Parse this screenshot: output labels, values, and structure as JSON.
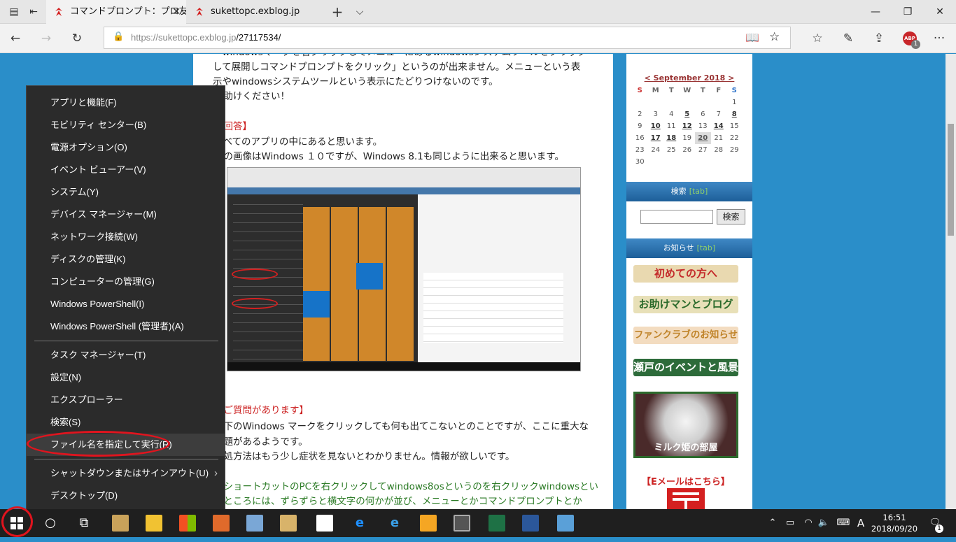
{
  "browser": {
    "tabs": [
      {
        "title": "コマンドプロンプト：プロ友パ"
      },
      {
        "title": "sukettopc.exblog.jp"
      }
    ],
    "url_host": "https://sukettopc.exblog.jp",
    "url_path": "/27117534/",
    "abp_badge": "ABP",
    "abp_count": "1"
  },
  "article": {
    "lines": [
      "「windowsマークを右クリックしてメニューにあるwindowsシステムツールをクリック",
      "して展開しコマンドプロンプトをクリック」というのが出来ません。メニューという表",
      "示やwindowsシステムツールという表示にたどりつけないのです。",
      "お助けください！",
      "【回答】",
      "すべてのアプリの中にあると思います。",
      "この画像はWindows １０ですが、Windows 8.1も同じように出来ると思います。",
      "【ご質問があります】",
      "左下のWindows マークをクリックしても何も出てこないとのことですが、ここに重大な",
      "問題があるようです。",
      "対処方法はもう少し症状を見ないとわかりません。情報が欲しいです。",
      "・ショートカットのPCを右クリックしてwindows8osというのを右クリックwindowsとい",
      "うところには、ずらずらと横文字の何かが並び、メニューとかコマンドプロンプトとか"
    ]
  },
  "sidebar": {
    "calendar_month": "< September 2018 >",
    "weekdays": [
      "S",
      "M",
      "T",
      "W",
      "T",
      "F",
      "S"
    ],
    "weeks": [
      [
        "",
        "",
        "",
        "",
        "",
        "",
        "1"
      ],
      [
        "2",
        "3",
        "4",
        "5",
        "6",
        "7",
        "8"
      ],
      [
        "9",
        "10",
        "11",
        "12",
        "13",
        "14",
        "15"
      ],
      [
        "16",
        "17",
        "18",
        "19",
        "20",
        "21",
        "22"
      ],
      [
        "23",
        "24",
        "25",
        "26",
        "27",
        "28",
        "29"
      ],
      [
        "30",
        "",
        "",
        "",
        "",
        "",
        ""
      ]
    ],
    "search_title": "検索",
    "search_tag": "[tab]",
    "search_button": "検索",
    "news_title": "お知らせ",
    "news_tag": "[tab]",
    "banners": [
      "初めての方へ",
      "お助けマンとブログ",
      "ファンクラブのお知らせ",
      "瀬戸のイベントと風景"
    ],
    "cat_caption": "ミルク姫の部屋",
    "email": "【Eメールはこちら】"
  },
  "context_menu": {
    "group1": [
      "アプリと機能(F)",
      "モビリティ センター(B)",
      "電源オプション(O)",
      "イベント ビューアー(V)",
      "システム(Y)",
      "デバイス マネージャー(M)",
      "ネットワーク接続(W)",
      "ディスクの管理(K)",
      "コンピューターの管理(G)",
      "Windows PowerShell(I)",
      "Windows PowerShell (管理者)(A)"
    ],
    "group2": [
      "タスク マネージャー(T)",
      "設定(N)",
      "エクスプローラー",
      "検索(S)",
      "ファイル名を指定して実行(R)"
    ],
    "group3": [
      "シャットダウンまたはサインアウト(U)",
      "デスクトップ(D)"
    ]
  },
  "taskbar": {
    "time": "16:51",
    "date": "2018/09/20",
    "ime": "A",
    "notif_count": "1"
  }
}
